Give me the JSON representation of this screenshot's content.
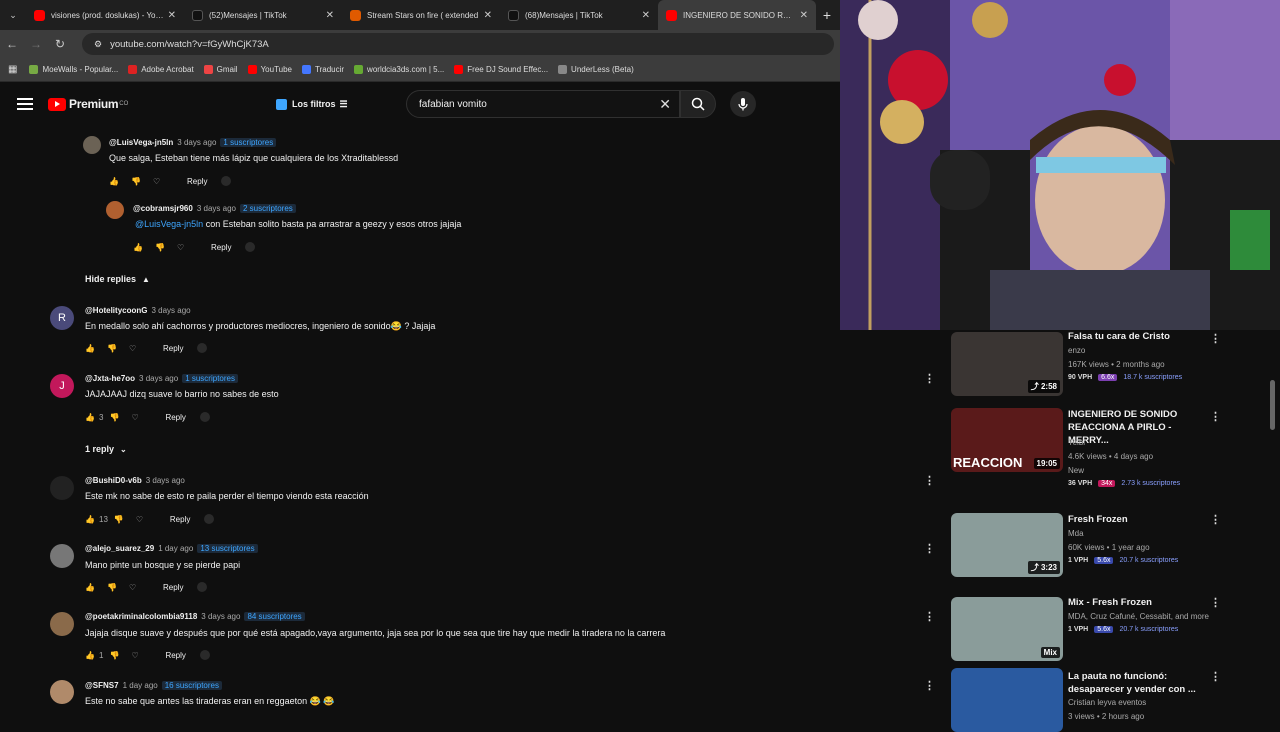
{
  "browser": {
    "tabs": [
      {
        "title": "visiones (prod. doslukas) - YouT",
        "color": "#ff0000"
      },
      {
        "title": "(52)Mensajes | TikTok",
        "color": "#111"
      },
      {
        "title": "Stream Stars on fire ( extended",
        "color": "#e05a00"
      },
      {
        "title": "(68)Mensajes | TikTok",
        "color": "#111"
      },
      {
        "title": "INGENIERO DE SONIDO REACC",
        "color": "#ff0000"
      }
    ],
    "url": "youtube.com/watch?v=fGyWhCjK73A",
    "bookmarks": [
      {
        "label": "MoeWalls - Popular...",
        "color": "#7a4"
      },
      {
        "label": "Adobe Acrobat",
        "color": "#d22"
      },
      {
        "label": "Gmail",
        "color": "#e44"
      },
      {
        "label": "YouTube",
        "color": "#f00"
      },
      {
        "label": "Traducir",
        "color": "#47f"
      },
      {
        "label": "worldcia3ds.com | 5...",
        "color": "#6a3"
      },
      {
        "label": "Free DJ Sound Effec...",
        "color": "#f00"
      },
      {
        "label": "UnderLess (Beta)",
        "color": "#888"
      }
    ]
  },
  "youtube": {
    "logo_text": "Premium",
    "country": "CO",
    "filters_label": "Los filtros",
    "search_value": "fafabian vomito"
  },
  "comments": [
    {
      "user": "@LuisVega-jn5ln",
      "date": "3 days ago",
      "badge": "1 suscriptores",
      "text": "Que salga, Esteban tiene más lápiz que cualquiera de los Xtraditablessd",
      "likes": "",
      "reply": "Reply"
    },
    {
      "user": "@cobramsjr960",
      "date": "3 days ago",
      "badge": "2 suscriptores",
      "mention": "@LuisVega-jn5ln",
      "text": " con Esteban solito basta pa arrastrar a geezy y esos otros jajaja",
      "likes": "",
      "reply": "Reply"
    },
    {
      "user": "@HotelitycoonG",
      "date": "3 days ago",
      "badge": "",
      "avatar": "R",
      "text": "En medallo solo ahí cachorros y productores mediocres, ingeniero de sonido😂 ? Jajaja",
      "likes": "",
      "reply": "Reply"
    },
    {
      "user": "@Jxta-he7oo",
      "date": "3 days ago",
      "badge": "1 suscriptores",
      "avatar": "J",
      "text": "JAJAJAAJ dizq suave lo barrio no sabes de esto",
      "likes": "3",
      "reply": "Reply"
    },
    {
      "user": "@BushiD0-v6b",
      "date": "3 days ago",
      "badge": "",
      "text": "Este mk no sabe de esto re paila perder el tiempo viendo esta reacción",
      "likes": "13",
      "reply": "Reply"
    },
    {
      "user": "@alejo_suarez_29",
      "date": "1 day ago",
      "badge": "13 suscriptores",
      "text": "Mano pinte un bosque y se pierde papi",
      "likes": "",
      "reply": "Reply"
    },
    {
      "user": "@poetakriminalcolombia9118",
      "date": "3 days ago",
      "badge": "84 suscriptores",
      "text": "Jajaja disque suave y después que por qué está apagado,vaya argumento, jaja sea por lo que sea que tire hay que medir la tiradera no la carrera",
      "likes": "1",
      "reply": "Reply"
    },
    {
      "user": "@SFNS7",
      "date": "1 day ago",
      "badge": "16 suscriptores",
      "text": "Este no sabe que antes las tiraderas eran en reggaeton 😂 😂",
      "likes": "",
      "reply": ""
    }
  ],
  "hide_replies": "Hide replies",
  "one_reply": "1 reply",
  "sidebar": [
    {
      "title": "Falsa tu cara de Cristo",
      "channel": "enzo",
      "stats": "167K views • 2 months ago",
      "vph": "90 VPH",
      "mult": "6.6x",
      "mult_color": "#7b3fb0",
      "subs": "18.7 k suscriptores",
      "duration": "2:58",
      "thumb": "#3a3533"
    },
    {
      "title": "INGENIERO DE SONIDO REACCIONA A PIRLO - MERRY...",
      "channel": "Yelbi",
      "stats": "4.6K views • 4 days ago",
      "extra": "New",
      "vph": "36 VPH",
      "mult": "34x",
      "mult_color": "#c2185b",
      "subs": "2.73 k suscriptores",
      "duration": "19:05",
      "thumb": "#5a1a1a",
      "thumb_text": "REACCION"
    },
    {
      "title": "Fresh Frozen",
      "channel": "Mda",
      "stats": "60K views • 1 year ago",
      "vph": "1 VPH",
      "mult": "5.6x",
      "mult_color": "#3949ab",
      "subs": "20.7 k suscriptores",
      "duration": "3:23",
      "thumb": "#7a8c8a"
    },
    {
      "title": "Mix - Fresh Frozen",
      "channel": "MDA, Cruz Cafuné, Cessabit, and more",
      "vph": "1 VPH",
      "mult": "5.6x",
      "mult_color": "#3949ab",
      "subs": "20.7 k suscriptores",
      "duration": "Mix",
      "thumb": "#7a8c8a"
    },
    {
      "title": "La pauta no funcionó: desaparecer y vender con ...",
      "channel": "Cristian leyva eventos",
      "stats": "3 views • 2 hours ago",
      "thumb": "#2a5aa0"
    }
  ]
}
